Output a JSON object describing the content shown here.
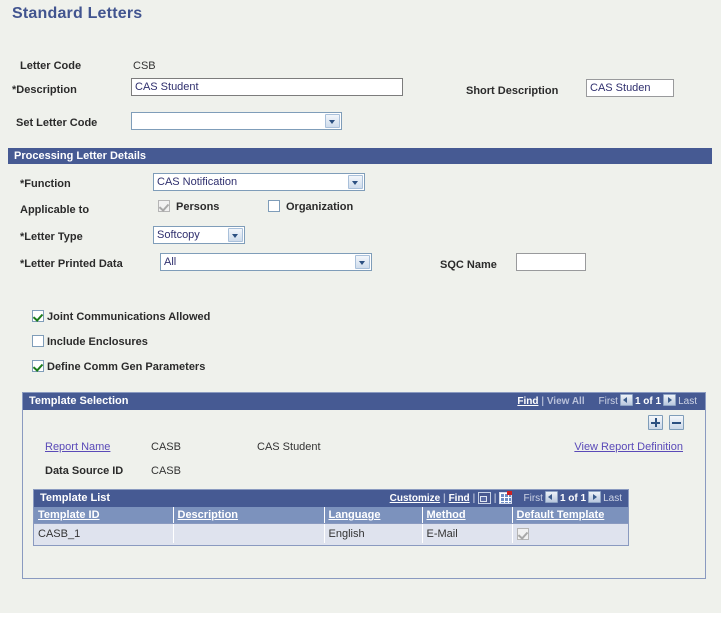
{
  "page": {
    "title": "Standard Letters"
  },
  "header_fields": {
    "letter_code_label": "Letter Code",
    "letter_code_value": "CSB",
    "description_label": "*Description",
    "description_value": "CAS Student",
    "short_description_label": "Short Description",
    "short_description_value": "CAS Studen",
    "set_letter_code_label": "Set Letter Code",
    "set_letter_code_value": ""
  },
  "processing": {
    "section_title": "Processing Letter Details",
    "function_label": "*Function",
    "function_value": "CAS Notification",
    "applicable_label": "Applicable to",
    "persons_label": "Persons",
    "organization_label": "Organization",
    "letter_type_label": "*Letter Type",
    "letter_type_value": "Softcopy",
    "letter_printed_data_label": "*Letter Printed Data",
    "letter_printed_data_value": "All",
    "sqc_name_label": "SQC Name",
    "sqc_name_value": "",
    "joint_comm_label": "Joint Communications Allowed",
    "include_enclosures_label": "Include Enclosures",
    "define_comm_gen_label": "Define Comm Gen Parameters"
  },
  "template_selection": {
    "title": "Template Selection",
    "find_label": "Find",
    "view_all_label": "View All",
    "first_label": "First",
    "count_label": "1 of 1",
    "last_label": "Last",
    "add_row_label": "+",
    "delete_row_label": "-",
    "report_name_label": "Report Name",
    "report_name_code": "CASB",
    "report_name_desc": "CAS Student",
    "view_report_definition_label": "View Report Definition",
    "data_source_id_label": "Data Source ID",
    "data_source_id_value": "CASB"
  },
  "template_list": {
    "title": "Template List",
    "customize_label": "Customize",
    "find_label": "Find",
    "expand_icon_label": "view-in-new-window",
    "download_icon_label": "download-to-spreadsheet",
    "first_label": "First",
    "count_label": "1 of 1",
    "last_label": "Last",
    "columns": [
      "Template ID",
      "Description",
      "Language",
      "Method",
      "Default Template"
    ],
    "rows": [
      {
        "template_id": "CASB_1",
        "description": "",
        "language": "English",
        "method": "E-Mail",
        "default_template": true
      }
    ]
  },
  "colors": {
    "header_bar": "#465a93",
    "grid_header": "#7c92bd",
    "page_bg": "#eff1ec",
    "title": "#41548f",
    "link": "#5a4ab8"
  }
}
